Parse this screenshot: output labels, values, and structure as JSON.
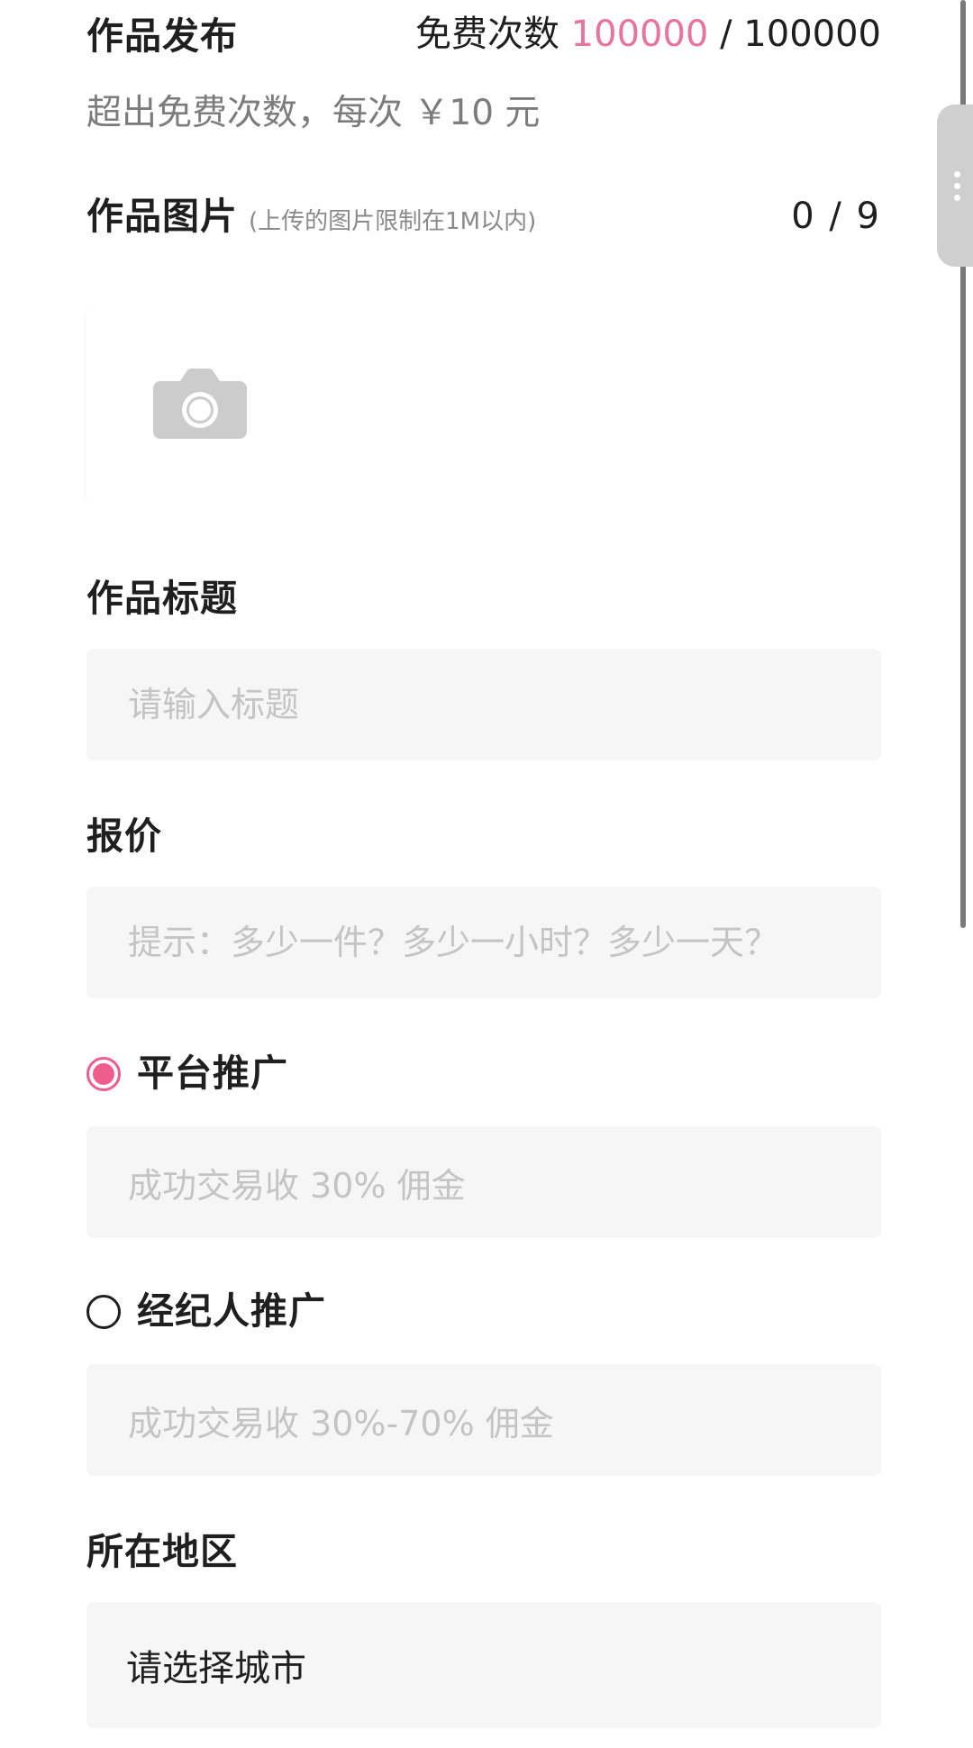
{
  "publish": {
    "title": "作品发布",
    "free_quota_label": "免费次数",
    "free_quota_used": "100000",
    "free_quota_separator": "/",
    "free_quota_total": "100000",
    "extra_fee_text": "超出免费次数，每次 ￥10 元"
  },
  "images": {
    "label": "作品图片",
    "hint": "(上传的图片限制在1M以内)",
    "count": "0 / 9",
    "upload_icon": "camera-icon"
  },
  "title_field": {
    "label": "作品标题",
    "placeholder": "请输入标题"
  },
  "price_field": {
    "label": "报价",
    "placeholder": "提示：多少一件？多少一小时？多少一天？"
  },
  "promotion": {
    "platform": {
      "label": "平台推广",
      "selected": true,
      "commission_text": "成功交易收 30% 佣金"
    },
    "agent": {
      "label": "经纪人推广",
      "selected": false,
      "commission_text": "成功交易收 30%-70% 佣金"
    }
  },
  "region": {
    "label": "所在地区",
    "select_text": "请选择城市"
  },
  "colors": {
    "accent": "#ee5d8b",
    "quota_used": "#e8739b",
    "field_bg": "#f6f6f6",
    "placeholder": "#c4c4c4"
  }
}
